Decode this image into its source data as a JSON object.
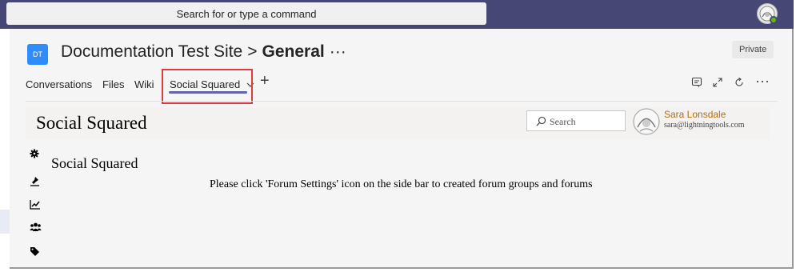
{
  "top_bar": {
    "search_placeholder": "Search for or type a command",
    "avatar_icon": "user-avatar-icon",
    "presence_status": "available",
    "background_color": "#464775"
  },
  "header": {
    "team_initials": "DT",
    "team_name": "Documentation Test Site",
    "separator": ">",
    "channel_name": "General",
    "more": "···",
    "privacy_badge": "Private"
  },
  "tabs": {
    "items": [
      {
        "label": "Conversations"
      },
      {
        "label": "Files"
      },
      {
        "label": "Wiki"
      },
      {
        "label": "Social Squared",
        "active": true,
        "dropdown_icon": "chevron-down-icon"
      }
    ],
    "add_icon": "+",
    "highlight_color": "#e23b3b",
    "accent_color": "#6264a7"
  },
  "toolbar": {
    "icons": [
      "chat-icon",
      "expand-icon",
      "refresh-icon",
      "more-icon"
    ],
    "more": "···"
  },
  "app": {
    "title": "Social Squared",
    "search_placeholder": "Search",
    "user_name": "Sara Lonsdale",
    "user_email": "sara@lightningtools.com",
    "sidebar_icons": [
      "forum-settings-gear-icon",
      "pin-icon",
      "chart-icon",
      "users-icon",
      "tags-icon"
    ],
    "content_heading": "Social Squared",
    "message": "Please click 'Forum Settings' icon on the side bar to created forum groups and forums"
  }
}
